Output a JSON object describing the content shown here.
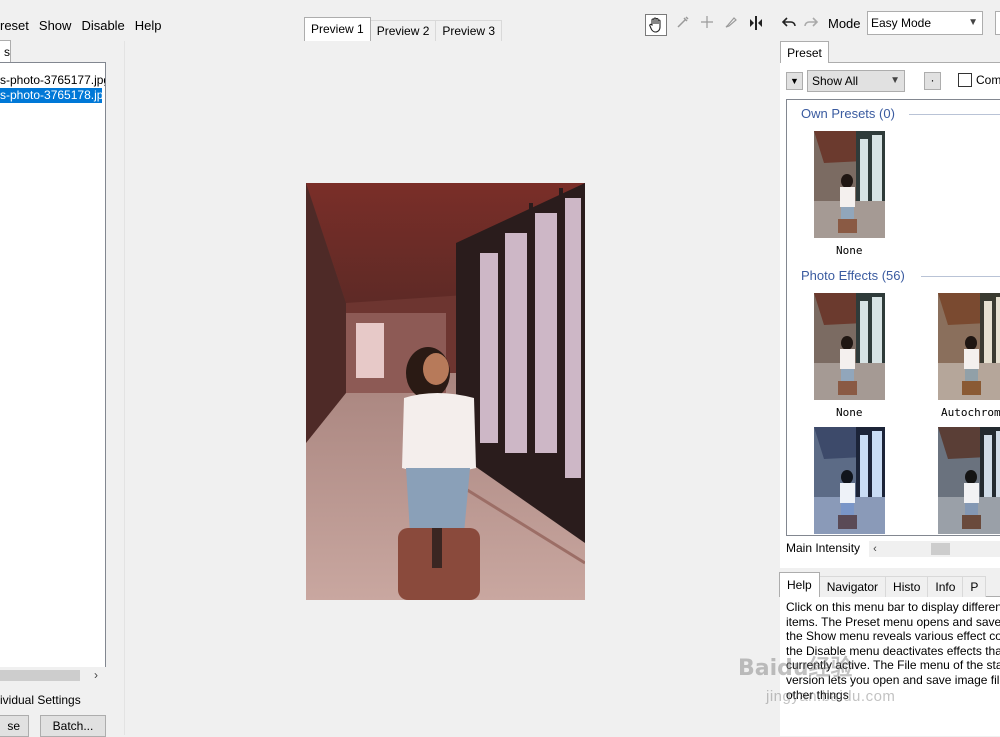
{
  "menu": [
    "reset",
    "Show",
    "Disable",
    "Help"
  ],
  "left_panel": {
    "tab_label": "s",
    "files": [
      "s-photo-3765177.jpg",
      "s-photo-3765178.jpg"
    ],
    "selected_index": 1,
    "individual_settings": "ividual Settings",
    "buttons": {
      "use": "se",
      "batch": "Batch..."
    },
    "scroll_arrow": "›"
  },
  "preview_tabs": [
    "Preview 1",
    "Preview 2",
    "Preview 3"
  ],
  "active_preview_tab": 0,
  "toolbar": {
    "icons": [
      "hand-icon",
      "eyedropper-icon",
      "crosshair-icon",
      "brush-icon",
      "split-view-icon",
      "undo-icon",
      "redo-icon"
    ],
    "mode_label": "Mode",
    "mode_value": "Easy Mode",
    "chevron": "⌄"
  },
  "preset_panel": {
    "tab_label": "Preset",
    "show_value": "Show All",
    "dot_button": "·",
    "compare_label": "Com",
    "groups": [
      {
        "title": "Own Presets (0)",
        "items": [
          "None"
        ]
      },
      {
        "title": "Photo Effects (56)",
        "items": [
          "None",
          "Autochrom",
          "",
          ""
        ]
      }
    ],
    "intensity_label": "Main Intensity",
    "intensity_arrow": "‹"
  },
  "help_panel": {
    "tabs": [
      "Help",
      "Navigator",
      "Histo",
      "Info",
      "P"
    ],
    "active_tab": 0,
    "text_lines": [
      "Click on this menu bar to display different",
      "items. The Preset menu opens and saves",
      "the Show menu reveals various effect co",
      "the Disable menu deactivates effects tha",
      "currently active. The File menu of the sta",
      "version lets you open and save image file",
      "other things"
    ]
  },
  "watermark": {
    "brand": "Baidu经验",
    "url": "jingyan.baidu.com"
  },
  "colors": {
    "selection": "#0078d7",
    "group_title": "#3a5ba0"
  }
}
